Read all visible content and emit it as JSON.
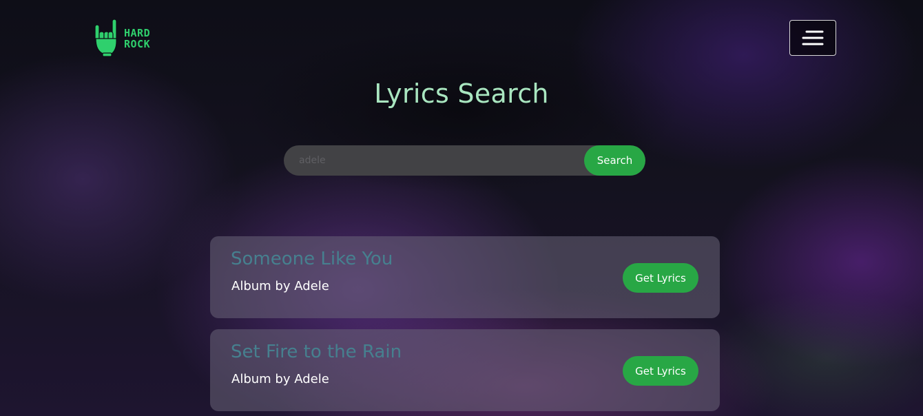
{
  "logo": {
    "line1": "HARD",
    "line2": "ROCK",
    "icon": "rock-hand-icon",
    "color": "#2fd06d"
  },
  "header": {
    "menu_icon": "hamburger-menu-icon"
  },
  "page": {
    "title": "Lyrics Search"
  },
  "search": {
    "value": "",
    "placeholder": "adele",
    "button_label": "Search"
  },
  "results": [
    {
      "title": "Someone Like You",
      "subtitle": "Album by Adele",
      "button_label": "Get Lyrics"
    },
    {
      "title": "Set Fire to the Rain",
      "subtitle": "Album by Adele",
      "button_label": "Get Lyrics"
    }
  ],
  "colors": {
    "accent": "#28a745",
    "title": "#a9e6c0",
    "result_title": "#46808f",
    "search_bg": "#424245"
  }
}
